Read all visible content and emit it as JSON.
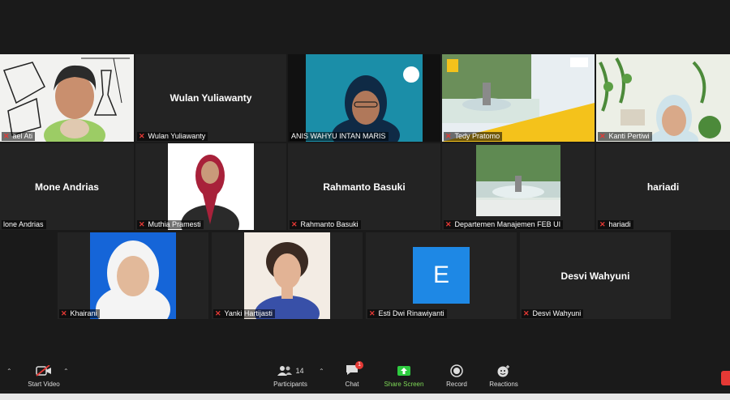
{
  "participants": [
    {
      "name": "Ishmael Ati",
      "tag": "ael Ati"
    },
    {
      "name": "Wulan Yuliawanty"
    },
    {
      "name": "ANIS WAHYU INTAN MARIS"
    },
    {
      "name": "Tedy Pratomo"
    },
    {
      "name": "Kanti Pertiwi"
    },
    {
      "name": "Mone Andrias",
      "tag": "lone Andrias"
    },
    {
      "name": "Muthia Pramesti"
    },
    {
      "name": "Rahmanto Basuki"
    },
    {
      "name": "Departemen Manajemen FEB UI"
    },
    {
      "name": "hariadi"
    },
    {
      "name": "Khairani"
    },
    {
      "name": "Yanki Hartijasti"
    },
    {
      "name": "Esti Dwi Rinawiyanti",
      "avatar_letter": "E"
    },
    {
      "name": "Desvi Wahyuni"
    }
  ],
  "toolbar": {
    "start_video": "Start Video",
    "participants": "Participants",
    "participants_count": "14",
    "chat": "Chat",
    "chat_badge": "1",
    "share_screen": "Share Screen",
    "record": "Record",
    "reactions": "Reactions",
    "left_partial": "e"
  },
  "colors": {
    "active_speaker": "#d4e157",
    "share_green": "#2ecc40",
    "mute_red": "#e53935",
    "avatar_blue": "#1e88e5"
  }
}
